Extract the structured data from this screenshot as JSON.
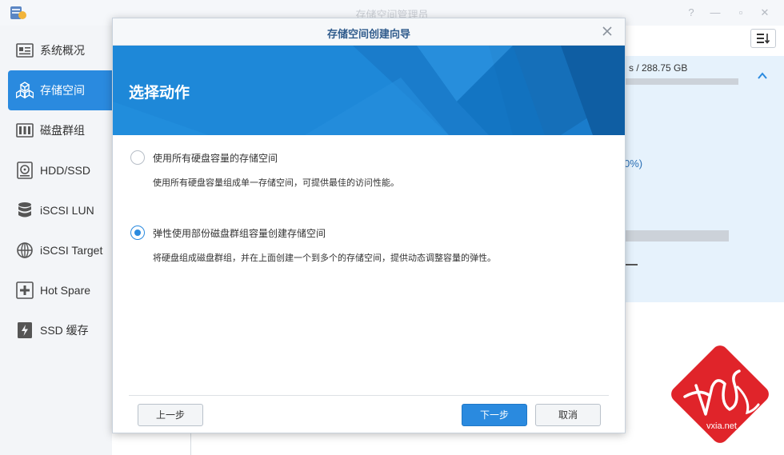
{
  "app": {
    "title": "存储空间管理员",
    "window_controls": [
      "help-icon",
      "pin-icon",
      "minimize-icon",
      "close-icon"
    ]
  },
  "sidebar": {
    "items": [
      {
        "label": "系统概况",
        "icon": "overview-icon",
        "active": false
      },
      {
        "label": "存储空间",
        "icon": "storage-cubes-icon",
        "active": true
      },
      {
        "label": "磁盘群组",
        "icon": "disk-group-icon",
        "active": false
      },
      {
        "label": "HDD/SSD",
        "icon": "hdd-icon",
        "active": false
      },
      {
        "label": "iSCSI LUN",
        "icon": "database-icon",
        "active": false
      },
      {
        "label": "iSCSI Target",
        "icon": "globe-icon",
        "active": false
      },
      {
        "label": "Hot Spare",
        "icon": "hot-spare-icon",
        "active": false
      },
      {
        "label": "SSD 缓存",
        "icon": "ssd-cache-icon",
        "active": false
      }
    ]
  },
  "background_panel": {
    "capacity_text": "s / 288.75 GB",
    "percent_text": "0%)",
    "sort_button_icon": "sort-icon"
  },
  "modal": {
    "title": "存储空间创建向导",
    "banner_title": "选择动作",
    "options": [
      {
        "label": "使用所有硬盘容量的存储空间",
        "description": "使用所有硬盘容量组成单一存储空间，可提供最佳的访问性能。",
        "checked": false
      },
      {
        "label": "弹性使用部份磁盘群组容量创建存储空间",
        "description": "将硬盘组成磁盘群组，并在上面创建一个到多个的存储空间，提供动态调整容量的弹性。",
        "checked": true
      }
    ],
    "buttons": {
      "prev": "上一步",
      "next": "下一步",
      "cancel": "取消"
    }
  },
  "watermark": {
    "text": "vxia.net"
  },
  "colors": {
    "accent": "#2a8adf",
    "banner": "#1e88d8",
    "panel": "#e6f2fc",
    "watermark": "#e0242a"
  }
}
